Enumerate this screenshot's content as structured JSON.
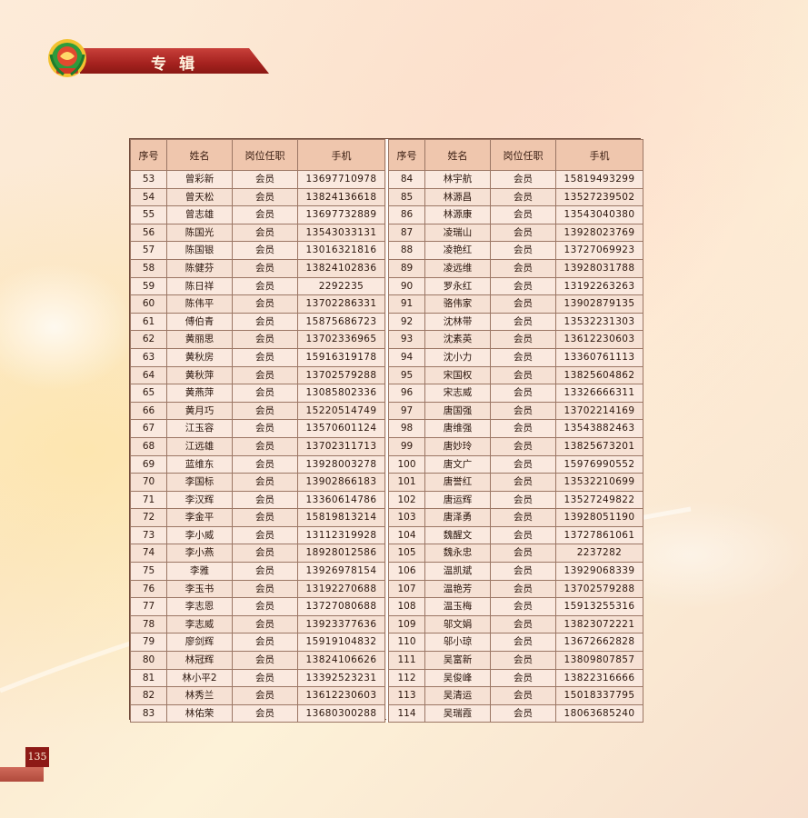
{
  "section_title": "专辑",
  "page_number": "135",
  "table": {
    "headers": [
      "序号",
      "姓名",
      "岗位任职",
      "手机"
    ],
    "left_rows": [
      [
        "53",
        "曾彩新",
        "会员",
        "13697710978"
      ],
      [
        "54",
        "曾天松",
        "会员",
        "13824136618"
      ],
      [
        "55",
        "曾志雄",
        "会员",
        "13697732889"
      ],
      [
        "56",
        "陈国光",
        "会员",
        "13543033131"
      ],
      [
        "57",
        "陈国银",
        "会员",
        "13016321816"
      ],
      [
        "58",
        "陈健芬",
        "会员",
        "13824102836"
      ],
      [
        "59",
        "陈日祥",
        "会员",
        "2292235"
      ],
      [
        "60",
        "陈伟平",
        "会员",
        "13702286331"
      ],
      [
        "61",
        "傅伯青",
        "会员",
        "15875686723"
      ],
      [
        "62",
        "黄丽思",
        "会员",
        "13702336965"
      ],
      [
        "63",
        "黄秋房",
        "会员",
        "15916319178"
      ],
      [
        "64",
        "黄秋萍",
        "会员",
        "13702579288"
      ],
      [
        "65",
        "黄燕萍",
        "会员",
        "13085802336"
      ],
      [
        "66",
        "黄月巧",
        "会员",
        "15220514749"
      ],
      [
        "67",
        "江玉容",
        "会员",
        "13570601124"
      ],
      [
        "68",
        "江远雄",
        "会员",
        "13702311713"
      ],
      [
        "69",
        "蓝维东",
        "会员",
        "13928003278"
      ],
      [
        "70",
        "李国标",
        "会员",
        "13902866183"
      ],
      [
        "71",
        "李汉辉",
        "会员",
        "13360614786"
      ],
      [
        "72",
        "李金平",
        "会员",
        "15819813214"
      ],
      [
        "73",
        "李小威",
        "会员",
        "13112319928"
      ],
      [
        "74",
        "李小燕",
        "会员",
        "18928012586"
      ],
      [
        "75",
        "李雅",
        "会员",
        "13926978154"
      ],
      [
        "76",
        "李玉书",
        "会员",
        "13192270688"
      ],
      [
        "77",
        "李志恩",
        "会员",
        "13727080688"
      ],
      [
        "78",
        "李志威",
        "会员",
        "13923377636"
      ],
      [
        "79",
        "廖剑辉",
        "会员",
        "15919104832"
      ],
      [
        "80",
        "林冠辉",
        "会员",
        "13824106626"
      ],
      [
        "81",
        "林小平2",
        "会员",
        "13392523231"
      ],
      [
        "82",
        "林秀兰",
        "会员",
        "13612230603"
      ],
      [
        "83",
        "林佑荣",
        "会员",
        "13680300288"
      ]
    ],
    "right_rows": [
      [
        "84",
        "林宇航",
        "会员",
        "15819493299"
      ],
      [
        "85",
        "林源昌",
        "会员",
        "13527239502"
      ],
      [
        "86",
        "林源康",
        "会员",
        "13543040380"
      ],
      [
        "87",
        "凌瑞山",
        "会员",
        "13928023769"
      ],
      [
        "88",
        "凌艳红",
        "会员",
        "13727069923"
      ],
      [
        "89",
        "凌远维",
        "会员",
        "13928031788"
      ],
      [
        "90",
        "罗永红",
        "会员",
        "13192263263"
      ],
      [
        "91",
        "骆伟家",
        "会员",
        "13902879135"
      ],
      [
        "92",
        "沈林带",
        "会员",
        "13532231303"
      ],
      [
        "93",
        "沈素英",
        "会员",
        "13612230603"
      ],
      [
        "94",
        "沈小力",
        "会员",
        "13360761113"
      ],
      [
        "95",
        "宋国权",
        "会员",
        "13825604862"
      ],
      [
        "96",
        "宋志威",
        "会员",
        "13326666311"
      ],
      [
        "97",
        "唐国强",
        "会员",
        "13702214169"
      ],
      [
        "98",
        "唐维强",
        "会员",
        "13543882463"
      ],
      [
        "99",
        "唐妙玲",
        "会员",
        "13825673201"
      ],
      [
        "100",
        "唐文广",
        "会员",
        "15976990552"
      ],
      [
        "101",
        "唐誉红",
        "会员",
        "13532210699"
      ],
      [
        "102",
        "唐运辉",
        "会员",
        "13527249822"
      ],
      [
        "103",
        "唐泽勇",
        "会员",
        "13928051190"
      ],
      [
        "104",
        "魏醒文",
        "会员",
        "13727861061"
      ],
      [
        "105",
        "魏永忠",
        "会员",
        "2237282"
      ],
      [
        "106",
        "温凯斌",
        "会员",
        "13929068339"
      ],
      [
        "107",
        "温艳芳",
        "会员",
        "13702579288"
      ],
      [
        "108",
        "温玉梅",
        "会员",
        "15913255316"
      ],
      [
        "109",
        "邬文娟",
        "会员",
        "13823072221"
      ],
      [
        "110",
        "邬小琼",
        "会员",
        "13672662828"
      ],
      [
        "111",
        "吴富新",
        "会员",
        "13809807857"
      ],
      [
        "112",
        "吴俊峰",
        "会员",
        "13822316666"
      ],
      [
        "113",
        "吴清运",
        "会员",
        "15018337795"
      ],
      [
        "114",
        "吴瑞霞",
        "会员",
        "18063685240"
      ]
    ]
  }
}
